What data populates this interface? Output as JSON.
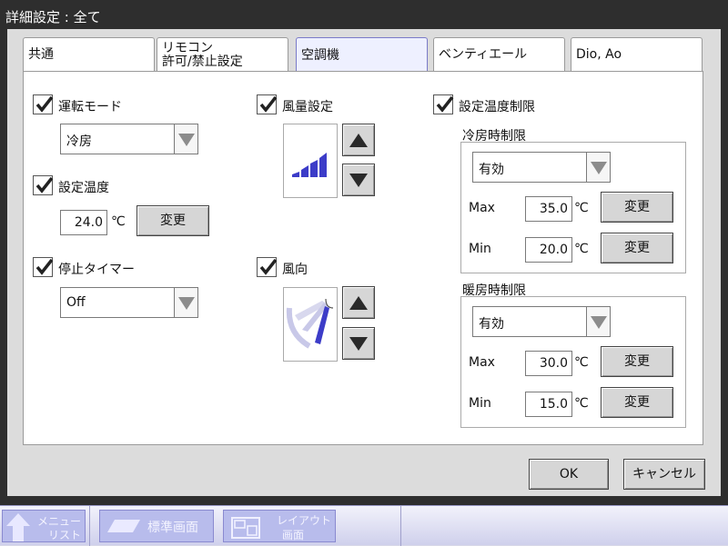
{
  "window": {
    "title": "詳細設定 : 全て"
  },
  "tabs": [
    {
      "label": "共通"
    },
    {
      "label_line1": "リモコン",
      "label_line2": "許可/禁止設定"
    },
    {
      "label": "空調機"
    },
    {
      "label": "ベンティエール"
    },
    {
      "label": "Dio, Ao"
    }
  ],
  "active_tab": "空調機",
  "mode": {
    "label": "運転モード",
    "checked": true,
    "value": "冷房"
  },
  "set_temp": {
    "label": "設定温度",
    "checked": true,
    "value": "24.0",
    "unit": "℃",
    "button": "変更"
  },
  "stop_timer": {
    "label": "停止タイマー",
    "checked": true,
    "value": "Off"
  },
  "fan_speed": {
    "label": "風量設定",
    "checked": true,
    "icon": "fan-speed-bars-icon"
  },
  "air_direction": {
    "label": "風向",
    "checked": true,
    "icon": "air-direction-icon"
  },
  "temp_limit": {
    "label": "設定温度制限",
    "checked": true,
    "cooling": {
      "title": "冷房時制限",
      "value": "有効",
      "max_label": "Max",
      "max": "35.0",
      "min_label": "Min",
      "min": "20.0",
      "unit": "℃",
      "button": "変更"
    },
    "heating": {
      "title": "暖房時制限",
      "value": "有効",
      "max_label": "Max",
      "max": "30.0",
      "min_label": "Min",
      "min": "15.0",
      "unit": "℃",
      "button": "変更"
    }
  },
  "footer": {
    "ok": "OK",
    "cancel": "キャンセル"
  },
  "dock": {
    "menu_line1": "メニュー",
    "menu_line2": "リスト",
    "standard": "標準画面",
    "layout_line1": "レイアウト",
    "layout_line2": "画面"
  },
  "colors": {
    "accent": "#3f3fc8",
    "tab_active": "#eef0ff",
    "dock": "#b8bcec"
  }
}
